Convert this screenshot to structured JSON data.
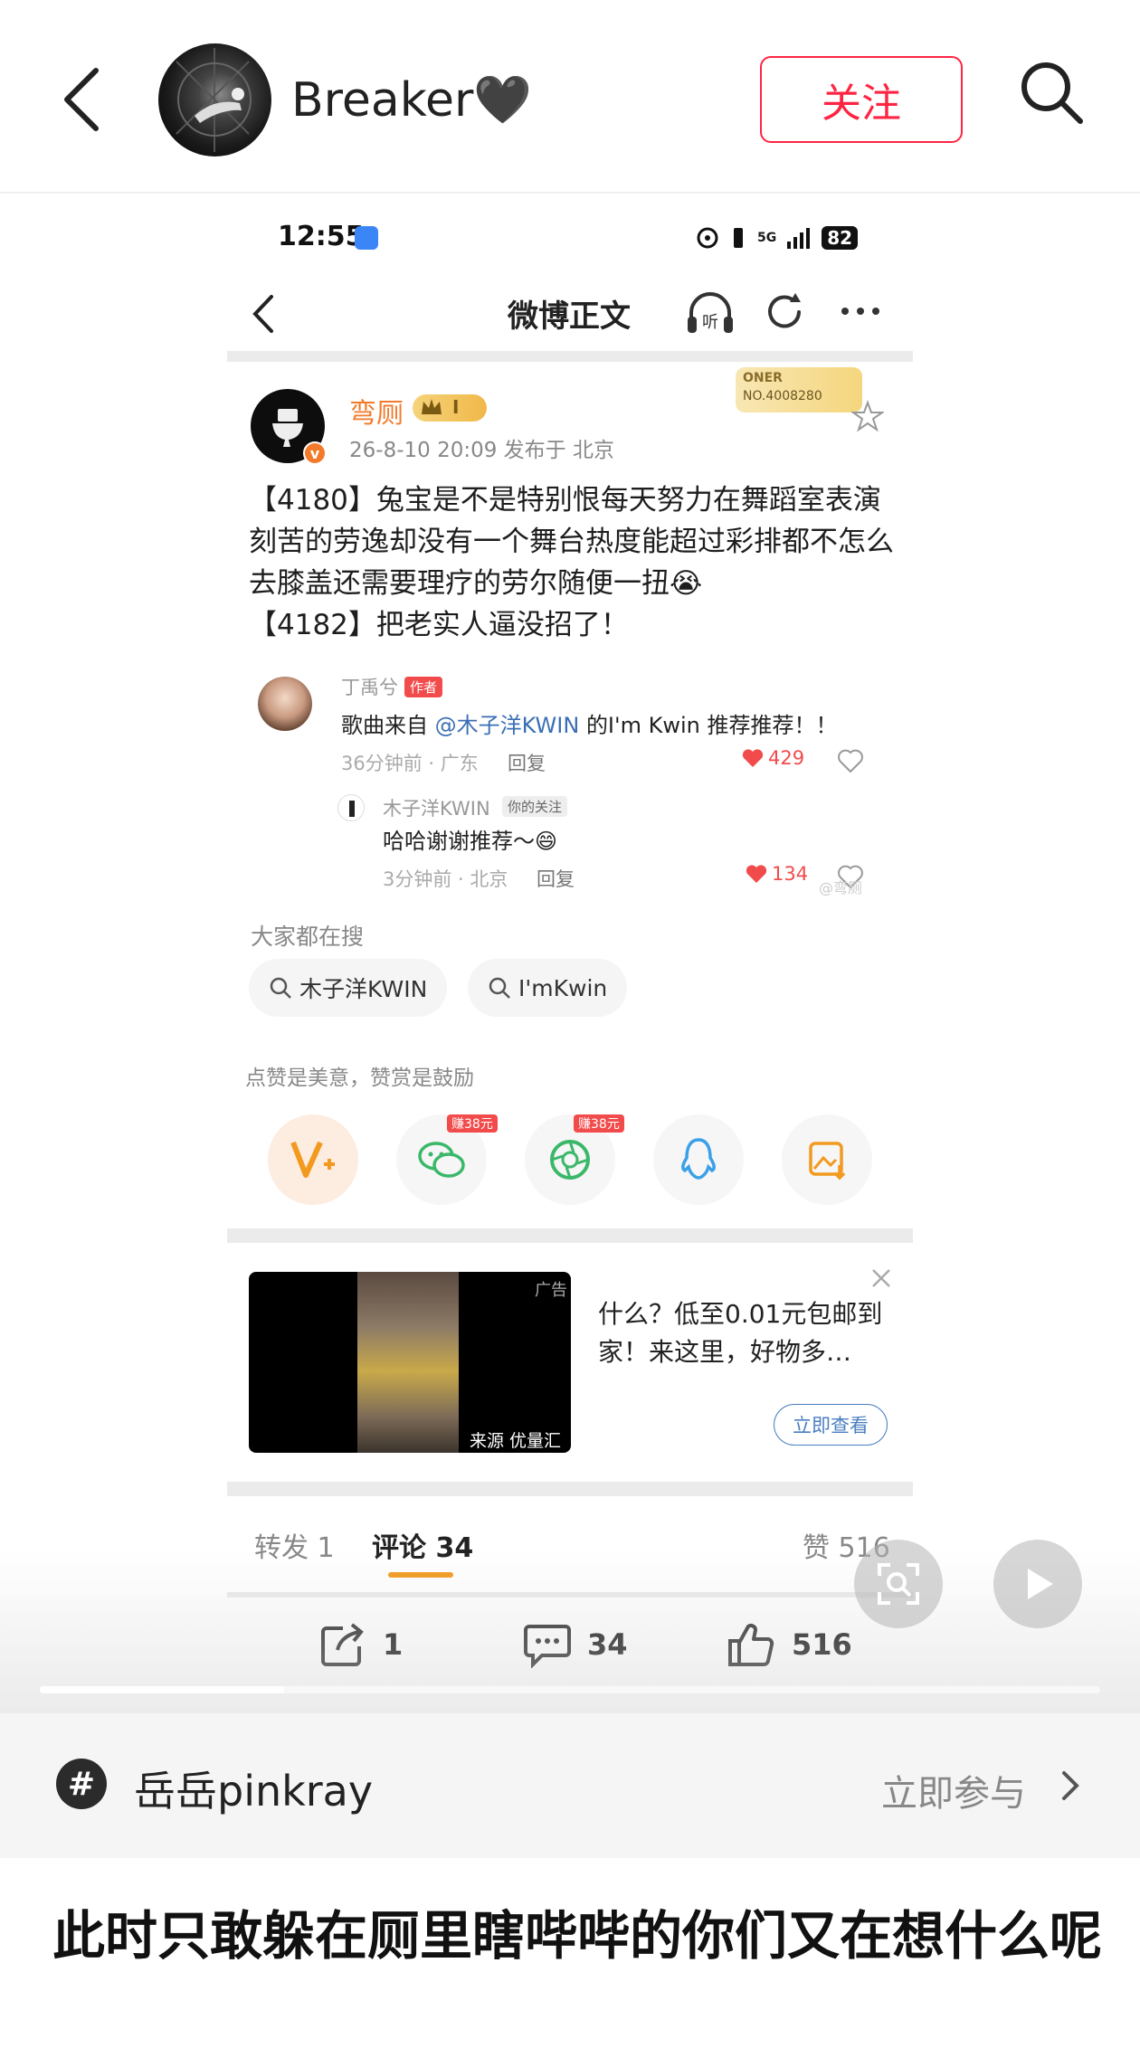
{
  "header": {
    "user_name": "Breaker🖤",
    "follow_label": "关注"
  },
  "screenshot": {
    "status": {
      "time": "12:55",
      "network": "5G",
      "battery": "82"
    },
    "nav": {
      "title": "微博正文"
    },
    "post": {
      "author": "弯厕",
      "vip_level": "I",
      "fans_badge_line1": "ONER",
      "fans_badge_line2": "NO.4008280",
      "meta": "26-8-10 20:09  发布于 北京",
      "text": "【4180】兔宝是不是特别恨每天努力在舞蹈室表演刻苦的劳逸却没有一个舞台热度能超过彩排都不怎么去膝盖还需要理疗的劳尔随便一扭😭\n【4182】把老实人逼没招了！"
    },
    "comments": [
      {
        "name": "丁禹兮",
        "tag": "作者",
        "text_before": "歌曲来自",
        "mention": "@木子洋KWIN",
        "text_after": "的I'm Kwin 推荐推荐！！",
        "meta": "36分钟前 · 广东",
        "reply": "回复",
        "likes": "429"
      },
      {
        "name": "木子洋KWIN",
        "tag": "你的关注",
        "text": "哈哈谢谢推荐～😄",
        "meta": "3分钟前 · 北京",
        "reply": "回复",
        "likes": "134",
        "watermark": "@弯厕"
      }
    ],
    "search": {
      "label": "大家都在搜",
      "chips": [
        "木子洋KWIN",
        "I'mKwin"
      ]
    },
    "reward": {
      "label": "点赞是美意，赞赏是鼓励",
      "earn_tags": [
        "赚38元",
        "赚38元"
      ]
    },
    "ad": {
      "tag": "广告",
      "source": "来源 优量汇",
      "text": "什么？低至0.01元包邮到家！来这里，好物多…",
      "button": "立即查看"
    },
    "tabs": [
      {
        "label": "转发 1"
      },
      {
        "label": "评论 34"
      },
      {
        "label": "赞 516"
      }
    ],
    "actions": [
      {
        "icon": "share-icon",
        "count": "1"
      },
      {
        "icon": "comment-icon",
        "count": "34"
      },
      {
        "icon": "like-icon",
        "count": "516"
      }
    ],
    "progress": 0.23
  },
  "topic": {
    "name": "岳岳pinkray",
    "join_label": "立即参与"
  },
  "post_title": "此时只敢躲在厕里瞎哔哔的你们又在想什么呢"
}
